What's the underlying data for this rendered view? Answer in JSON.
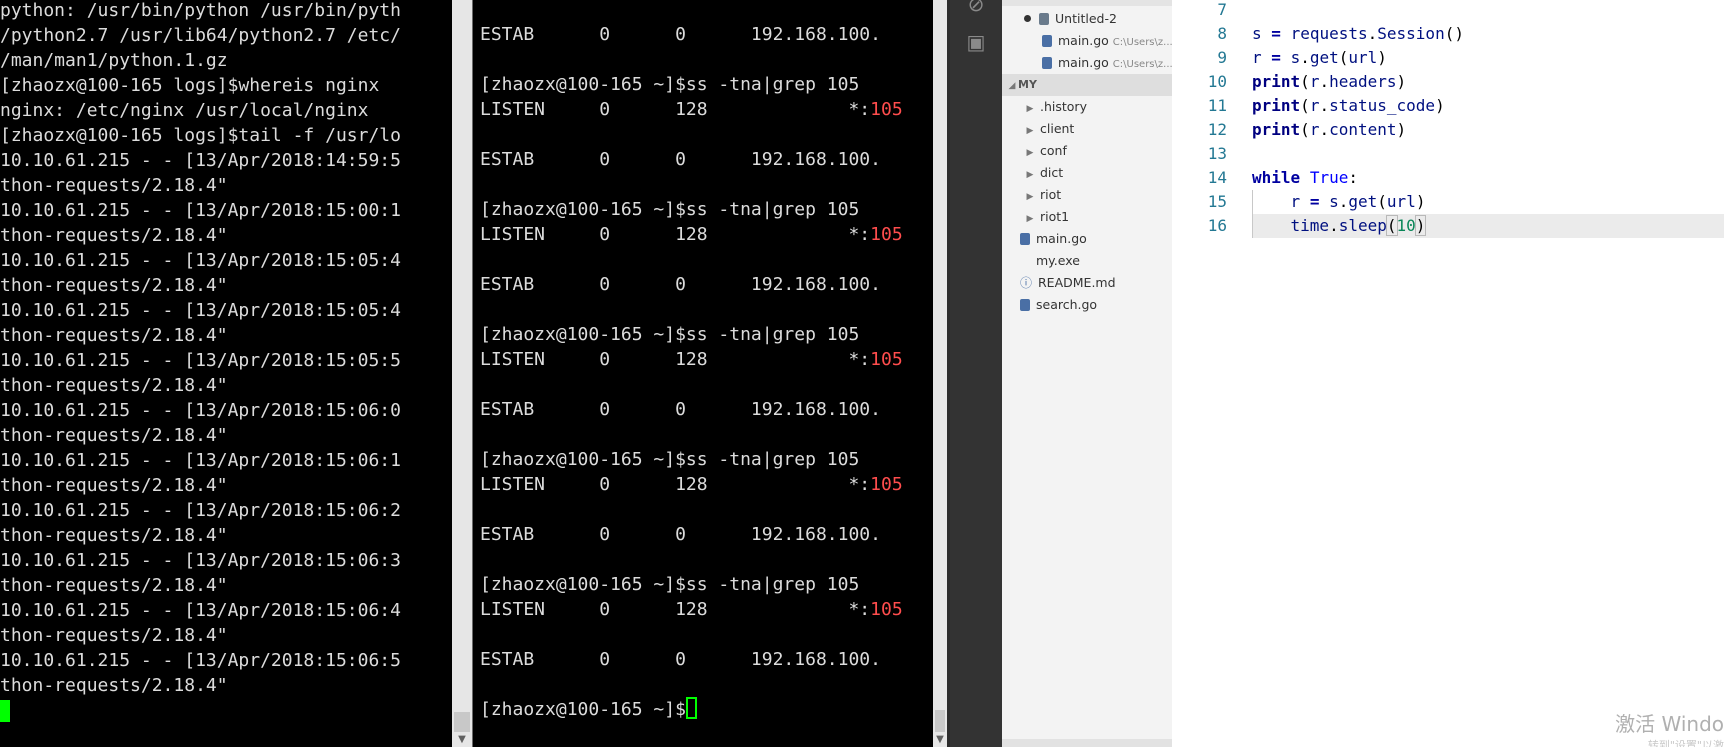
{
  "terminal_left": {
    "lines": [
      "python: /usr/bin/python /usr/bin/pyth",
      "/python2.7 /usr/lib64/python2.7 /etc/",
      "/man/man1/python.1.gz",
      "[zhaozx@100-165 logs]$whereis nginx",
      "nginx: /etc/nginx /usr/local/nginx",
      "[zhaozx@100-165 logs]$tail -f /usr/lo",
      "10.10.61.215 - - [13/Apr/2018:14:59:5",
      "thon-requests/2.18.4\"",
      "10.10.61.215 - - [13/Apr/2018:15:00:1",
      "thon-requests/2.18.4\"",
      "10.10.61.215 - - [13/Apr/2018:15:05:4",
      "thon-requests/2.18.4\"",
      "10.10.61.215 - - [13/Apr/2018:15:05:4",
      "thon-requests/2.18.4\"",
      "10.10.61.215 - - [13/Apr/2018:15:05:5",
      "thon-requests/2.18.4\"",
      "10.10.61.215 - - [13/Apr/2018:15:06:0",
      "thon-requests/2.18.4\"",
      "10.10.61.215 - - [13/Apr/2018:15:06:1",
      "thon-requests/2.18.4\"",
      "10.10.61.215 - - [13/Apr/2018:15:06:2",
      "thon-requests/2.18.4\"",
      "10.10.61.215 - - [13/Apr/2018:15:06:3",
      "thon-requests/2.18.4\"",
      "10.10.61.215 - - [13/Apr/2018:15:06:4",
      "thon-requests/2.18.4\"",
      "10.10.61.215 - - [13/Apr/2018:15:06:5",
      "thon-requests/2.18.4\""
    ]
  },
  "terminal_right": {
    "estab_line": "ESTAB      0      0      192.168.100.",
    "prompt_cmd": "[zhaozx@100-165 ~]$ss -tna|grep 105",
    "listen_prefix": "LISTEN     0      128             *:",
    "listen_port": "105",
    "final_prompt": "[zhaozx@100-165 ~]$"
  },
  "explorer": {
    "open_editors": [
      {
        "name": "Untitled-2",
        "hint": ""
      },
      {
        "name": "main.go",
        "hint": "C:\\Users\\z..."
      },
      {
        "name": "main.go",
        "hint": "C:\\Users\\z..."
      }
    ],
    "section_title": "MY",
    "folders": [
      ".history",
      "client",
      "conf",
      "dict",
      "riot",
      "riot1"
    ],
    "files": [
      "main.go",
      "my.exe",
      "README.md",
      "search.go"
    ]
  },
  "editor": {
    "line_numbers": [
      "7",
      "8",
      "9",
      "10",
      "11",
      "12",
      "13",
      "14",
      "15",
      "16"
    ]
  },
  "watermark": {
    "title": "激活 Windo",
    "subtitle": "转到\"设置\"以激"
  },
  "colors": {
    "terminal_bg": "#000000",
    "terminal_fg": "#dcdcdc",
    "port_red": "#ff4d4d",
    "cursor_green": "#00ff00",
    "activity_bar": "#333333",
    "sidebar_bg": "#f3f3f3"
  }
}
